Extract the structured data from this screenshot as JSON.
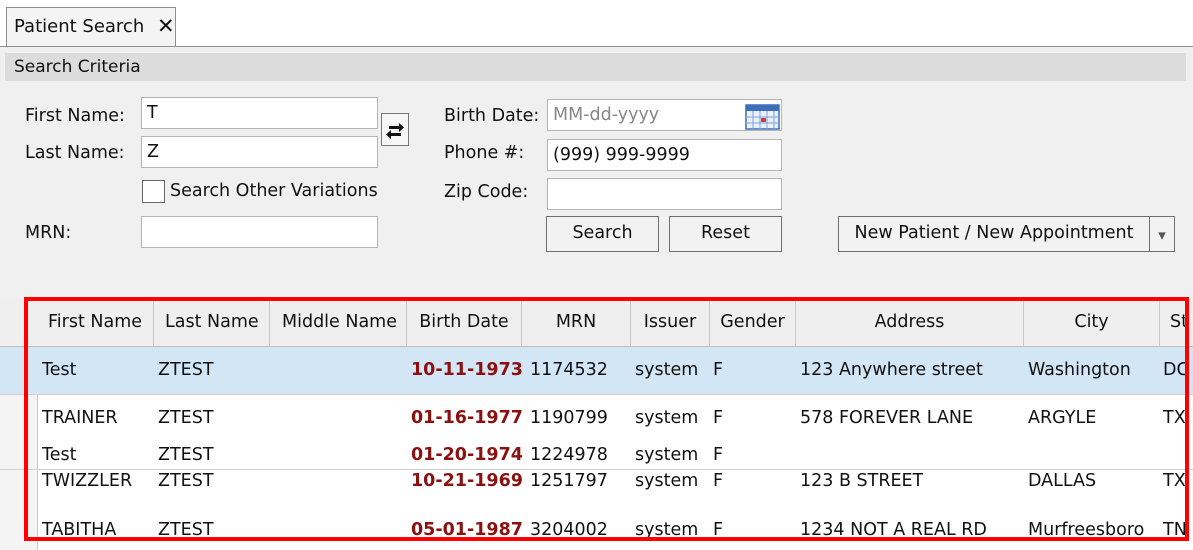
{
  "tab": {
    "label": "Patient Search",
    "close_glyph": "✕"
  },
  "section": {
    "title": "Search Criteria"
  },
  "form": {
    "first_name_label": "First Name:",
    "first_name_value": "T",
    "last_name_label": "Last Name:",
    "last_name_value": "Z",
    "search_other_variations_label": "Search Other Variations",
    "mrn_label": "MRN:",
    "mrn_value": "",
    "birth_date_label": "Birth Date:",
    "birth_date_placeholder": "MM-dd-yyyy",
    "phone_label": "Phone #:",
    "phone_value": "(999) 999-9999",
    "zip_label": "Zip Code:",
    "zip_value": ""
  },
  "buttons": {
    "search": "Search",
    "reset": "Reset",
    "new_patient": "New Patient / New Appointment",
    "dropdown_glyph": "▾"
  },
  "grid": {
    "columns": [
      "First Name",
      "Last Name",
      "Middle Name",
      "Birth Date",
      "MRN",
      "Issuer",
      "Gender",
      "Address",
      "City",
      "St"
    ],
    "rows": [
      {
        "first": "Test",
        "last": "ZTEST",
        "middle": "",
        "dob": "10-11-1973",
        "mrn": "1174532",
        "issuer": "system",
        "gender": "F",
        "address": "123 Anywhere street",
        "city": "Washington",
        "state": "DC"
      },
      {
        "first": "TRAINER",
        "last": "ZTEST",
        "middle": "",
        "dob": "01-16-1977",
        "mrn": "1190799",
        "issuer": "system",
        "gender": "F",
        "address": "578 FOREVER LANE",
        "city": "ARGYLE",
        "state": "TX"
      },
      {
        "first": "Test",
        "last": "ZTEST",
        "middle": "",
        "dob": "01-20-1974",
        "mrn": "1224978",
        "issuer": "system",
        "gender": "F",
        "address": "",
        "city": "",
        "state": ""
      },
      {
        "first": "TWIZZLER",
        "last": "ZTEST",
        "middle": "",
        "dob": "10-21-1969",
        "mrn": "1251797",
        "issuer": "system",
        "gender": "F",
        "address": "123 B STREET",
        "city": "DALLAS",
        "state": "TX"
      },
      {
        "first": "TABITHA",
        "last": "ZTEST",
        "middle": "",
        "dob": "05-01-1987",
        "mrn": "3204002",
        "issuer": "system",
        "gender": "F",
        "address": "1234 NOT A REAL RD",
        "city": "Murfreesboro",
        "state": "TN"
      }
    ]
  },
  "colors": {
    "highlight": "#ff0000",
    "date_text": "#8b1010",
    "selected_row": "#d3e6f5"
  }
}
